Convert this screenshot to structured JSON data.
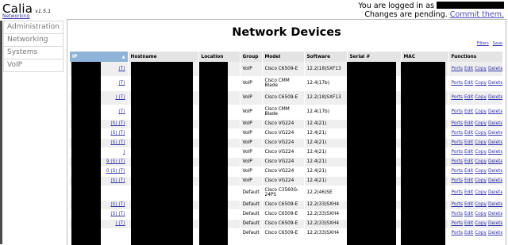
{
  "app": {
    "name": "Calia",
    "version": "v1.5.1",
    "section_link": "Networking"
  },
  "session": {
    "logged_in_text": "You are logged in as",
    "pending_text": "Changes are pending.",
    "commit_label": "Commit them."
  },
  "nav": {
    "items": [
      "Administration",
      "Networking",
      "Systems",
      "VoIP"
    ]
  },
  "page": {
    "title": "Network Devices",
    "filters_label": "Filters",
    "save_label": "Save"
  },
  "table": {
    "columns": [
      "IP",
      "Hostname",
      "Location",
      "Group",
      "Model",
      "Software",
      "Serial #",
      "MAC",
      "Functions"
    ],
    "actions": [
      "Ports",
      "Edit",
      "Copy",
      "Delete"
    ],
    "rows": [
      {
        "tags": "(T)",
        "group": "VoIP",
        "model": "Cisco C6509-E",
        "software": "12.2(18)SXF13"
      },
      {
        "tags": "(T)",
        "group": "VoIP",
        "model": "Cisco CMM Blade",
        "software": "12.4(17b)"
      },
      {
        "tags": ") (T)",
        "group": "VoIP",
        "model": "Cisco C6509-E",
        "software": "12.2(18)SXF13"
      },
      {
        "tags": "(T)",
        "group": "VoIP",
        "model": "Cisco CMM Blade",
        "software": "12.4(17b)"
      },
      {
        "tags": "(S) (T)",
        "group": "VoIP",
        "model": "Cisco VG224",
        "software": "12.4(21)"
      },
      {
        "tags": "(S) (T)",
        "group": "VoIP",
        "model": "Cisco VG224",
        "software": "12.4(21)"
      },
      {
        "tags": "(S) (T)",
        "group": "VoIP",
        "model": "Cisco VG224",
        "software": "12.4(21)"
      },
      {
        "tags": ")",
        "group": "VoIP",
        "model": "Cisco VG224",
        "software": "12.4(21)"
      },
      {
        "tags": "9 (S) (T)",
        "group": "VoIP",
        "model": "Cisco VG224",
        "software": "12.4(21)"
      },
      {
        "tags": "0 (S) (T)",
        "group": "VoIP",
        "model": "Cisco VG224",
        "software": "12.4(21)"
      },
      {
        "tags": "(S) (T)",
        "group": "VoIP",
        "model": "Cisco VG224",
        "software": "12.4(21)"
      },
      {
        "tags": "",
        "group": "Default",
        "model": "Cisco C3560G-24PS",
        "software": "12.2(46)SE"
      },
      {
        "tags": "(S) (T)",
        "group": "Default",
        "model": "Cisco C6509-E",
        "software": "12.2(33)SXH4"
      },
      {
        "tags": "(S) (T)",
        "group": "Default",
        "model": "Cisco C6509-E",
        "software": "12.2(33)SXH4"
      },
      {
        "tags": ") (T)",
        "group": "Default",
        "model": "Cisco C6509-E",
        "software": "12.2(33)SXH4"
      },
      {
        "tags": "",
        "group": "Default",
        "model": "Cisco C6509-E",
        "software": "12.2(33)SXH4"
      }
    ]
  }
}
